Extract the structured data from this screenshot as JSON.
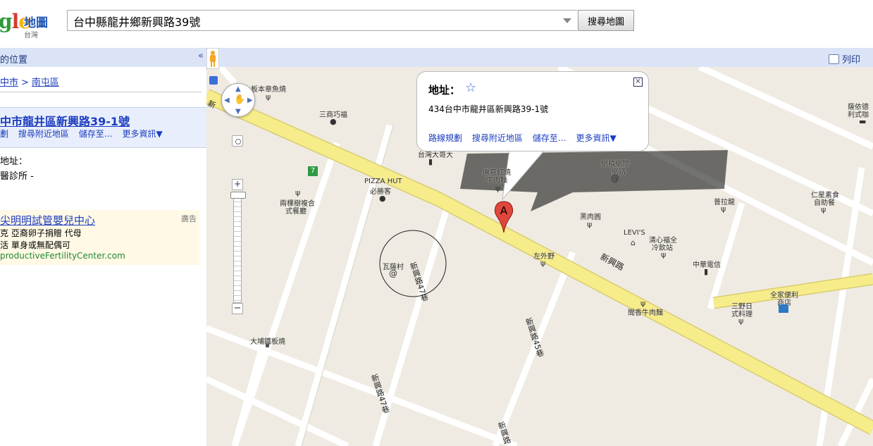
{
  "header": {
    "logo_text": "gle",
    "logo_product": "地圖",
    "logo_region": "台灣",
    "search_value": "台中縣龍井鄉新興路39號",
    "search_button": "搜尋地圖"
  },
  "left_panel": {
    "header_title": "的位置",
    "collapse_label": "«",
    "breadcrumb": [
      "中市",
      "南屯區"
    ],
    "breadcrumb_sep": ">",
    "result": {
      "title": "中市龍井區新興路39-1號",
      "links": [
        "劃",
        "搜尋附近地區",
        "儲存至…",
        "更多資訊▼"
      ]
    },
    "address_label": "地址：",
    "address_value": "醫診所 -",
    "ad": {
      "title": "尖明明試管嬰兒中心",
      "tag": "廣告",
      "line1": "克 亞裔卵子捐贈 代母",
      "line2": "活 單身或無配偶可",
      "url": "productiveFertilityCenter.com"
    }
  },
  "map": {
    "print_label": "列印",
    "marker_letter": "A",
    "info_window": {
      "title": "地址：",
      "address": "434台中市龍井區新興路39-1號",
      "links": [
        "路線規劃",
        "搜尋附近地區",
        "儲存至…",
        "更多資訊▼"
      ]
    },
    "road_labels": {
      "main_left": "新",
      "main_right": "新興路",
      "lane_47_a": "新興路47巷",
      "lane_47_b": "新興路47巷",
      "lane_45": "新興路45巷",
      "lane_bottom": "新興路"
    },
    "places": {
      "p1": "板本章魚燒",
      "p2": "三商巧福",
      "p3": "台灣大哥大",
      "p4": "PIZZA HUT",
      "p4b": "必勝客",
      "p5": "兩棵樹複合",
      "p5b": "式餐廳",
      "p6": "瓦薩村",
      "p7": "盧意紅燒",
      "p7b": "牛肉麵",
      "p8": "網槓網際",
      "p8b": "網路",
      "p9": "黑肉圓",
      "p10": "LEVI'S",
      "p11": "清心福全",
      "p11b": "冷飲站",
      "p12": "左外野",
      "p13": "普拉龍",
      "p14": "仁星素食",
      "p14b": "自助餐",
      "p15": "中華電信",
      "p16": "全家便利",
      "p16b": "商店",
      "p17": "三野日",
      "p17b": "式料理",
      "p18": "聞香牛肉麵",
      "p19": "大埔鐵板燒",
      "p20": "薩依德",
      "p20b": "利式咖"
    },
    "colors": {
      "main_road": "#f7ec8a",
      "side_road": "#ffffff",
      "land": "#efebe2",
      "marker": "#e0463c"
    }
  }
}
